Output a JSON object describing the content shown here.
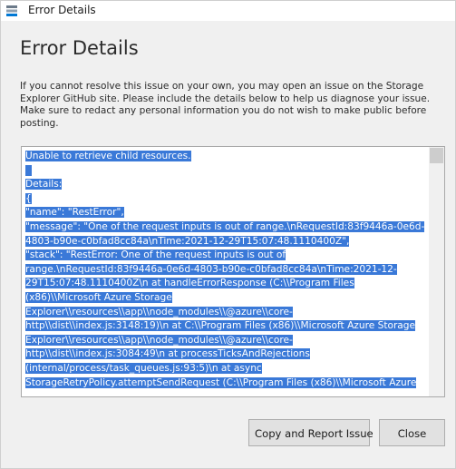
{
  "window": {
    "title": "Error Details"
  },
  "dialog": {
    "heading": "Error Details",
    "description": "If you cannot resolve this issue on your own, you may open an issue on the Storage Explorer GitHub site. Please include the details below to help us diagnose your issue. Make sure to redact any personal information you do not wish to make public before posting."
  },
  "details": {
    "lines": [
      "Unable to retrieve child resources.",
      "",
      "Details:",
      "{",
      "  \"name\": \"RestError\",",
      "  \"message\": \"One of the request inputs is out of range.\\nRequestId:83f9446a-0e6d-",
      "4803-b90e-c0bfad8cc84a\\nTime:2021-12-29T15:07:48.1110400Z\",",
      "  \"stack\": \"RestError: One of the request inputs is out of",
      "range.\\nRequestId:83f9446a-0e6d-4803-b90e-c0bfad8cc84a\\nTime:2021-12-",
      "29T15:07:48.1110400Z\\n    at handleErrorResponse (C:\\\\Program Files",
      "(x86)\\\\Microsoft Azure Storage",
      "Explorer\\\\resources\\\\app\\\\node_modules\\\\@azure\\\\core-",
      "http\\\\dist\\\\index.js:3148:19)\\n    at C:\\\\Program Files (x86)\\\\Microsoft Azure Storage",
      "Explorer\\\\resources\\\\app\\\\node_modules\\\\@azure\\\\core-",
      "http\\\\dist\\\\index.js:3084:49\\n    at processTicksAndRejections",
      "(internal/process/task_queues.js:93:5)\\n    at async",
      "StorageRetryPolicy.attemptSendRequest (C:\\\\Program Files (x86)\\\\Microsoft Azure"
    ]
  },
  "buttons": {
    "report": "Copy and Report Issue",
    "close": "Close"
  },
  "colors": {
    "selection": "#3a79d8",
    "window_bg": "#f0f0f0",
    "button_bg": "#e1e1e1"
  },
  "icons": {
    "title": "storage-explorer-icon"
  }
}
